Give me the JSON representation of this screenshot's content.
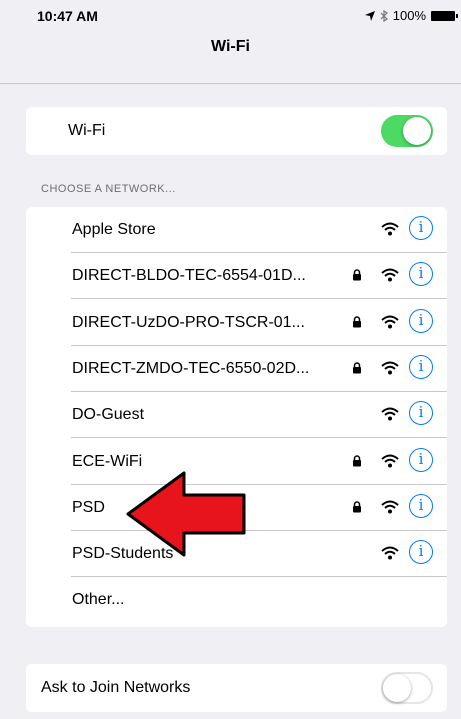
{
  "status": {
    "time": "10:47 AM",
    "battery": "100%"
  },
  "nav": {
    "title": "Wi-Fi"
  },
  "wifi": {
    "label": "Wi-Fi",
    "enabled": true
  },
  "section": {
    "header": "CHOOSE A NETWORK..."
  },
  "networks": [
    {
      "name": "Apple Store",
      "locked": false,
      "info": "i"
    },
    {
      "name": "DIRECT-BLDO-TEC-6554-01D...",
      "locked": true,
      "info": "i"
    },
    {
      "name": "DIRECT-UzDO-PRO-TSCR-01...",
      "locked": true,
      "info": "i"
    },
    {
      "name": "DIRECT-ZMDO-TEC-6550-02D...",
      "locked": true,
      "info": "i"
    },
    {
      "name": "DO-Guest",
      "locked": false,
      "info": "i"
    },
    {
      "name": "ECE-WiFi",
      "locked": true,
      "info": "i"
    },
    {
      "name": "PSD",
      "locked": true,
      "info": "i"
    },
    {
      "name": "PSD-Students",
      "locked": false,
      "info": "i"
    },
    {
      "name": "Other...",
      "locked": false,
      "info": ""
    }
  ],
  "ask": {
    "label": "Ask to Join Networks",
    "enabled": false
  },
  "annotation": {
    "arrow_color": "#e8141c"
  },
  "colors": {
    "accent": "#007aff",
    "toggle_on": "#4cd964"
  }
}
